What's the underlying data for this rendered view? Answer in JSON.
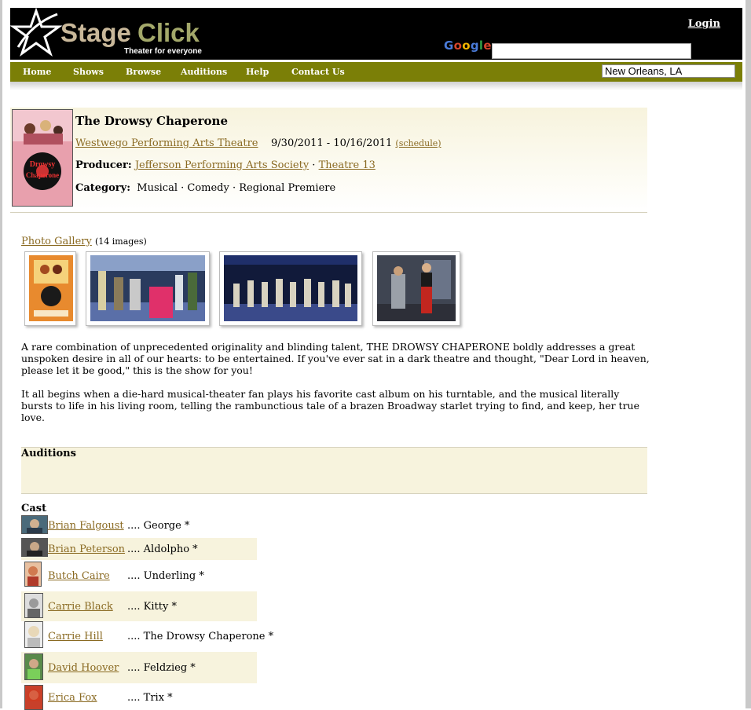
{
  "header": {
    "brand_name": "StageClick",
    "tagline": "Theater for everyone",
    "login_label": "Login",
    "search_logo": "Google",
    "search_value": "",
    "location_value": "New Orleans, LA"
  },
  "nav": {
    "items": [
      {
        "label": "Home"
      },
      {
        "label": "Shows"
      },
      {
        "label": "Browse"
      },
      {
        "label": "Auditions"
      },
      {
        "label": "Help"
      },
      {
        "label": "Contact Us"
      }
    ]
  },
  "show": {
    "title": "The Drowsy Chaperone",
    "venue": "Westwego Performing Arts Theatre",
    "dates": "9/30/2011 - 10/16/2011",
    "schedule_label": "(schedule)",
    "producer_label": "Producer:",
    "producers": [
      "Jefferson Performing Arts Society",
      "Theatre 13"
    ],
    "category_label": "Category:",
    "categories": "Musical · Comedy · Regional Premiere"
  },
  "gallery": {
    "link_label": "Photo Gallery",
    "count_label": "(14 images)"
  },
  "description": {
    "para1": "A rare combination of unprecedented originality and blinding talent, THE DROWSY CHAPERONE boldly addresses a great unspoken desire in all of our hearts: to be entertained. If you've ever sat in a dark theatre and thought, \"Dear Lord in heaven, please let it be good,\" this is the show for you!",
    "para2": "It all begins when a die-hard musical-theater fan plays his favorite cast album on his turntable, and the musical literally bursts to life in his living room, telling the rambunctious tale of a brazen Broadway starlet trying to find, and keep, her true love."
  },
  "auditions": {
    "title": "Auditions"
  },
  "cast": {
    "title": "Cast",
    "members": [
      {
        "name": "Brian Falgoust",
        "role": ".... George *"
      },
      {
        "name": "Brian Peterson",
        "role": ".... Aldolpho *"
      },
      {
        "name": "Butch Caire",
        "role": ".... Underling *"
      },
      {
        "name": "Carrie Black",
        "role": ".... Kitty *"
      },
      {
        "name": "Carrie Hill",
        "role": ".... The Drowsy Chaperone *"
      },
      {
        "name": "David Hoover",
        "role": ".... Feldzieg *"
      },
      {
        "name": "Erica Fox",
        "role": ".... Trix *"
      }
    ]
  },
  "colors": {
    "nav_bar": "#7b7f07",
    "link": "#8a6a22",
    "panel": "#f7f3dd"
  }
}
